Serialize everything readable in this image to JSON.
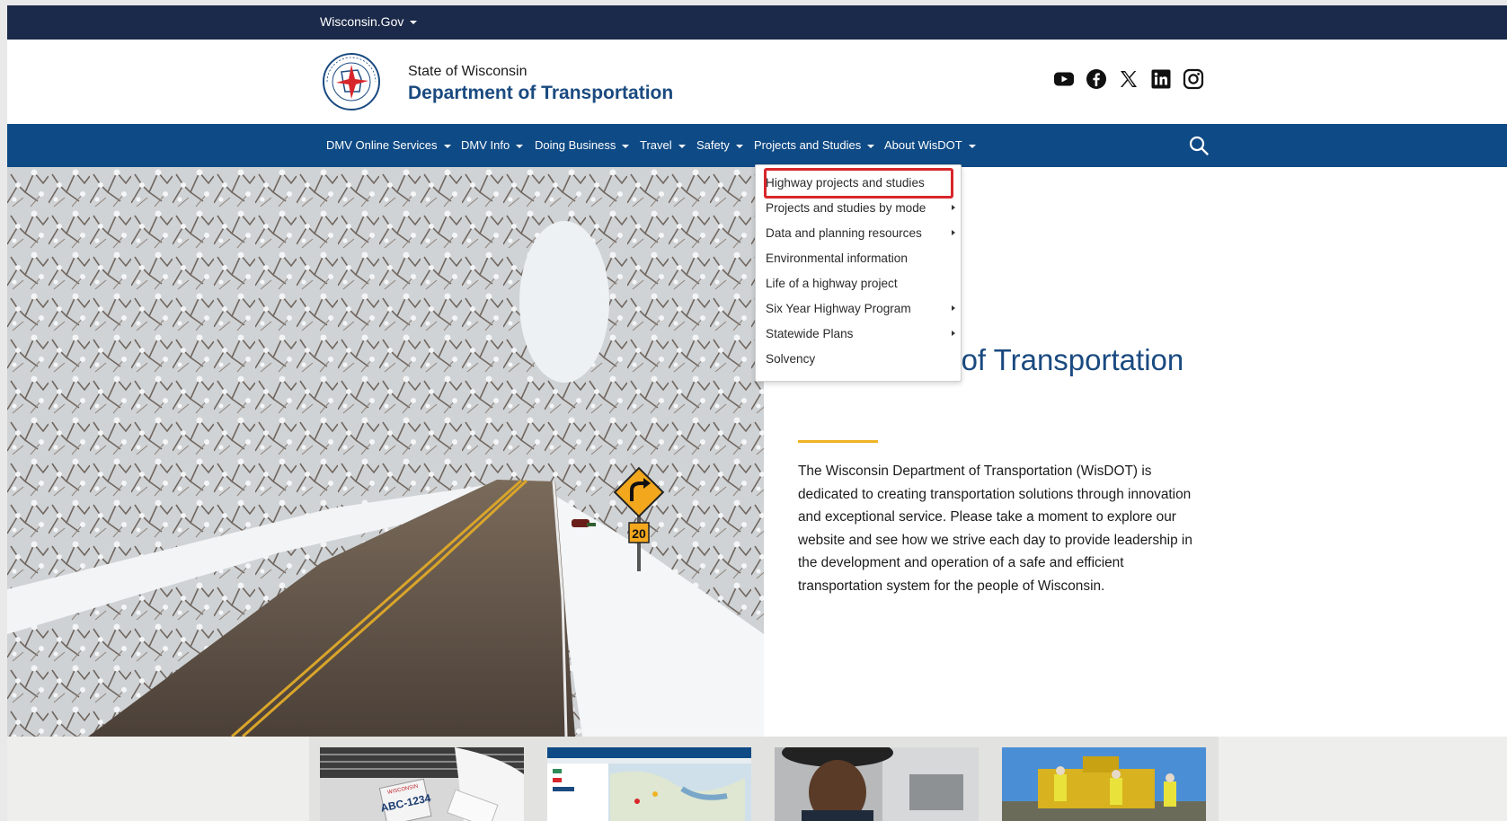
{
  "gov_bar": {
    "label": "Wisconsin.Gov"
  },
  "header": {
    "state": "State of Wisconsin",
    "department": "Department of Transportation",
    "seal_icon": "wisdot-seal-icon",
    "social_icons": [
      "youtube-icon",
      "facebook-icon",
      "x-icon",
      "linkedin-icon",
      "instagram-icon"
    ]
  },
  "nav": {
    "items": [
      "DMV Online Services",
      "DMV Info",
      "Doing Business",
      "Travel",
      "Safety",
      "Projects and Studies",
      "About WisDOT"
    ],
    "search_icon": "search-icon"
  },
  "dropdown": {
    "items": [
      {
        "label": "Highway projects and studies",
        "submenu": false
      },
      {
        "label": "Projects and studies by mode",
        "submenu": true
      },
      {
        "label": "Data and planning resources",
        "submenu": true
      },
      {
        "label": "Environmental information",
        "submenu": false
      },
      {
        "label": "Life of a highway project",
        "submenu": false
      },
      {
        "label": "Six Year Highway Program",
        "submenu": true
      },
      {
        "label": "Statewide Plans",
        "submenu": true
      },
      {
        "label": "Solvency",
        "submenu": false
      }
    ]
  },
  "hero": {
    "title": "Department of Transportation",
    "intro": "The Wisconsin Department of Transportation (WisDOT) is dedicated to creating transportation solutions through innovation and exceptional service. Please take a moment to explore our website and see how we strive each day to provide leadership in the development and operation of a safe and efficient transportation system for the people of Wisconsin.",
    "sign_speed": "20"
  },
  "cards": {
    "plate_text": "ABC-1234",
    "plate_state": "WISCONSIN"
  },
  "colors": {
    "gov_bar": "#1b2a4a",
    "nav": "#0e4a85",
    "brand_blue": "#1a4a80",
    "gold": "#f0b323",
    "highlight_red": "#d7262b"
  }
}
